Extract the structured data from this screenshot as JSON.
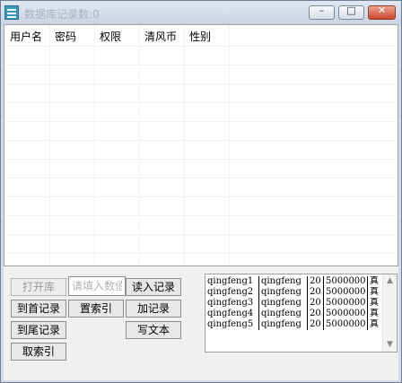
{
  "window": {
    "title": "数据库记录数:0"
  },
  "grid": {
    "columns": [
      "用户名",
      "密码",
      "权限",
      "清风币",
      "性别"
    ]
  },
  "buttons": {
    "open_db": "打开库",
    "read_record": "读入记录",
    "to_first": "到首记录",
    "set_index": "置索引",
    "add_record": "加记录",
    "to_last": "到尾记录",
    "write_text": "写文本",
    "get_index": "取索引"
  },
  "input": {
    "placeholder": "请填入数值",
    "value": ""
  },
  "records": [
    {
      "user": "qingfeng1",
      "pwd": "qingfeng",
      "perm": "20",
      "coins": "5000000",
      "gender": "真"
    },
    {
      "user": "qingfeng2",
      "pwd": "qingfeng",
      "perm": "20",
      "coins": "5000000",
      "gender": "真"
    },
    {
      "user": "qingfeng3",
      "pwd": "qingfeng",
      "perm": "20",
      "coins": "5000000",
      "gender": "真"
    },
    {
      "user": "qingfeng4",
      "pwd": "qingfeng",
      "perm": "20",
      "coins": "5000000",
      "gender": "真"
    },
    {
      "user": "qingfeng5",
      "pwd": "qingfeng",
      "perm": "20",
      "coins": "5000000",
      "gender": "真"
    }
  ]
}
